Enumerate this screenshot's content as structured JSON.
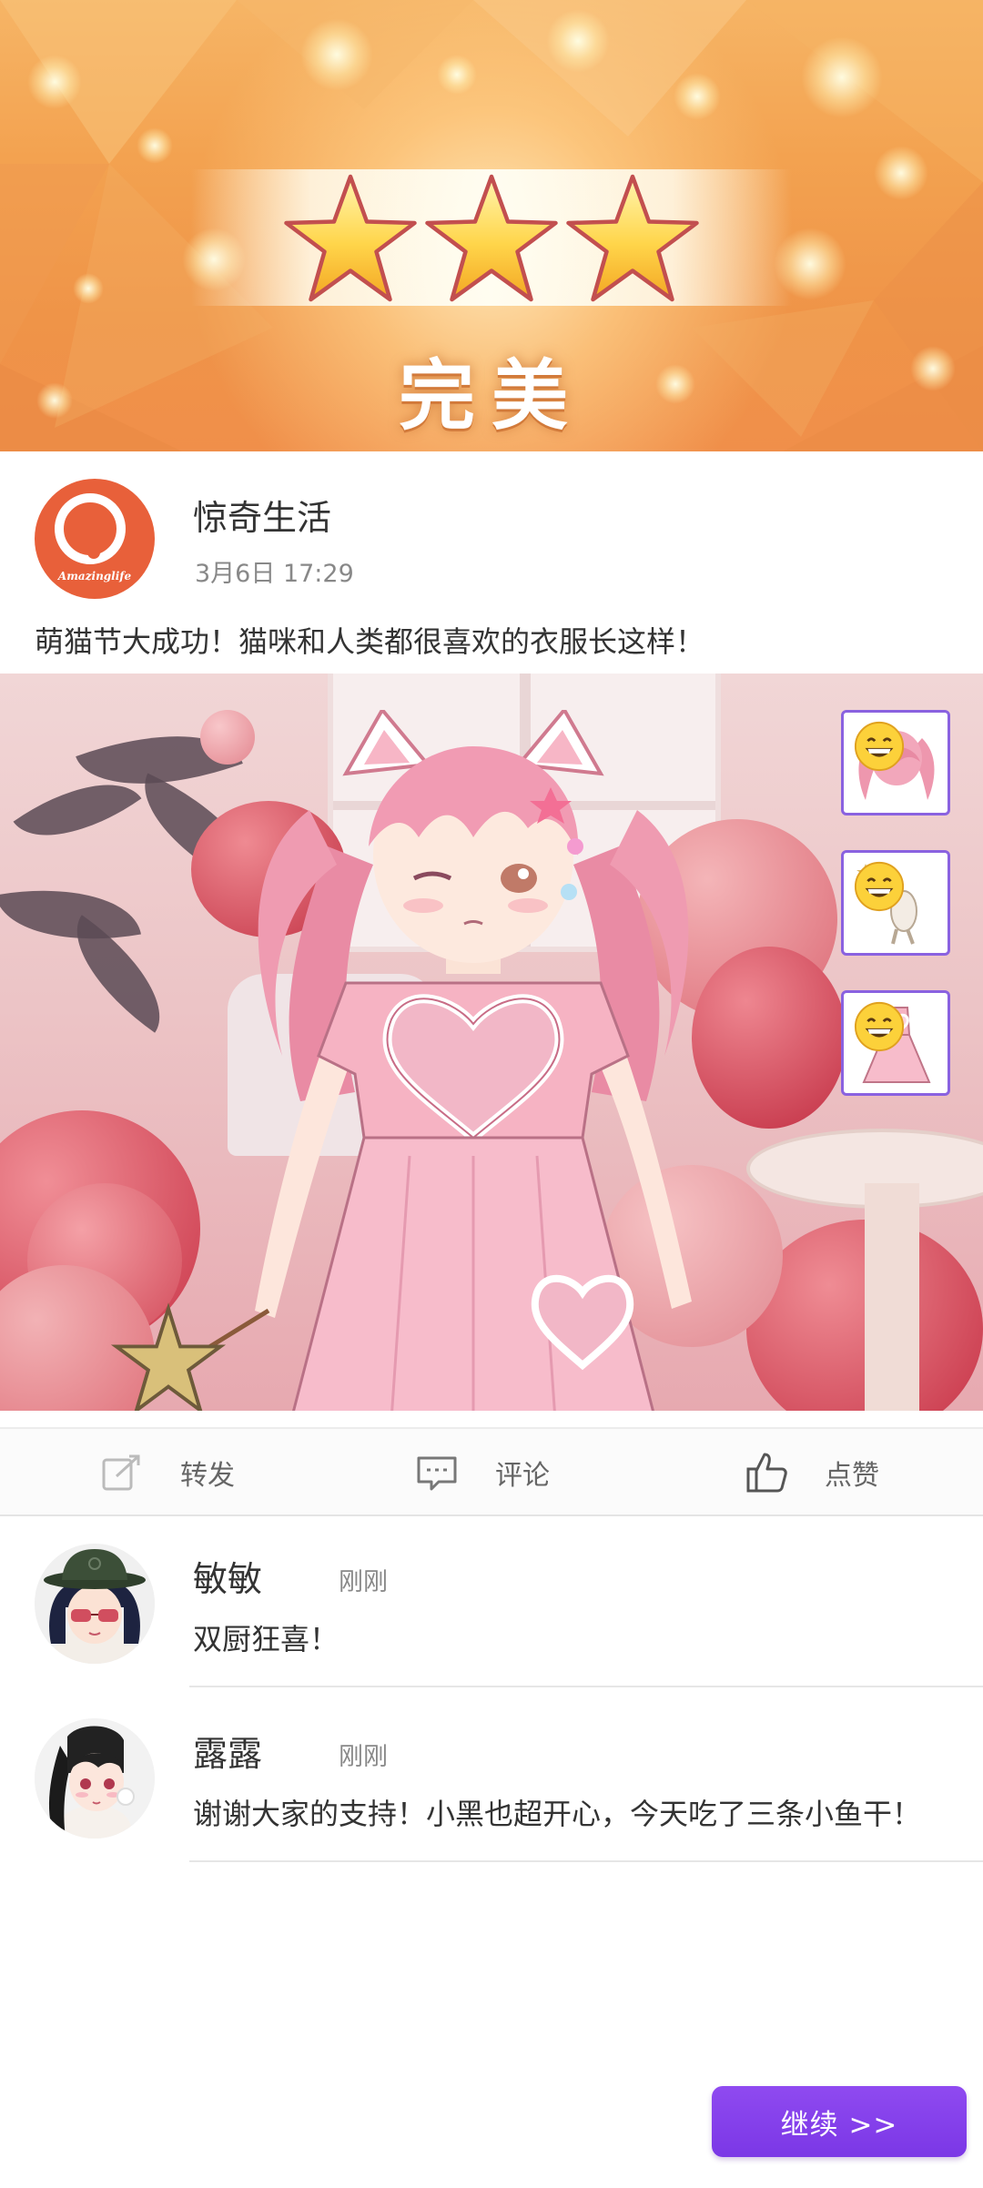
{
  "banner": {
    "rating": 3,
    "rating_max": 3,
    "rating_text": "完美"
  },
  "post": {
    "account_name": "惊奇生活",
    "account_logo_text": "Amazinglife",
    "timestamp": "3月6日 17:29",
    "text": "萌猫节大成功！猫咪和人类都很喜欢的衣服长这样！",
    "items": [
      {
        "icon": "pink-twin-tail-hair-icon",
        "reaction_icon": "grinning-emoji-icon"
      },
      {
        "icon": "cat-with-wand-icon",
        "reaction_icon": "grinning-emoji-icon"
      },
      {
        "icon": "pink-dress-icon",
        "reaction_icon": "grinning-emoji-icon"
      }
    ]
  },
  "actions": {
    "forward_label": "转发",
    "comment_label": "评论",
    "like_label": "点赞"
  },
  "comments": [
    {
      "name": "敏敏",
      "time": "刚刚",
      "text": "双厨狂喜！"
    },
    {
      "name": "露露",
      "time": "刚刚",
      "text": "谢谢大家的支持！小黑也超开心，今天吃了三条小鱼干！"
    }
  ],
  "continue_button": {
    "label": "继续 >>"
  },
  "colors": {
    "banner_orange": "#f3a250",
    "logo_orange": "#e8603a",
    "accent_purple": "#7b37e6",
    "item_border": "#8a62e0"
  }
}
